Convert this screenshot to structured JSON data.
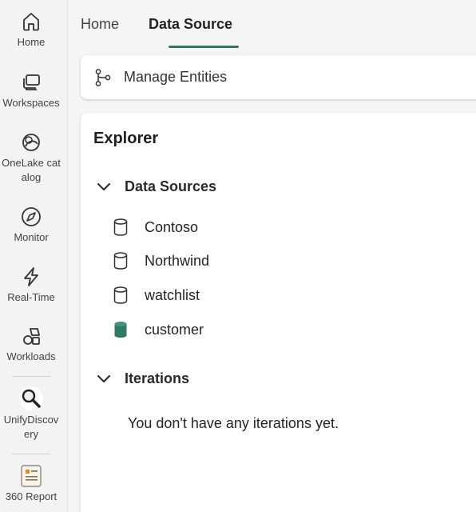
{
  "rail": {
    "items": [
      {
        "label": "Home",
        "icon": "home-icon"
      },
      {
        "label": "Workspaces",
        "icon": "workspaces-icon"
      },
      {
        "label": "OneLake catalog",
        "icon": "onelake-catalog-icon"
      },
      {
        "label": "Monitor",
        "icon": "monitor-icon"
      },
      {
        "label": "Real-Time",
        "icon": "real-time-icon"
      },
      {
        "label": "Workloads",
        "icon": "workloads-icon"
      },
      {
        "label": "UnifyDiscovery",
        "icon": "magnifier-icon"
      },
      {
        "label": "360 Report",
        "icon": "report-icon"
      }
    ]
  },
  "tabs": [
    {
      "label": "Home",
      "active": false
    },
    {
      "label": "Data Source",
      "active": true
    }
  ],
  "toolbar": {
    "manage_entities_label": "Manage Entities"
  },
  "explorer": {
    "title": "Explorer",
    "data_sources_header": "Data Sources",
    "data_sources": [
      {
        "name": "Contoso",
        "selected": false
      },
      {
        "name": "Northwind",
        "selected": false
      },
      {
        "name": "watchlist",
        "selected": false
      },
      {
        "name": "customer",
        "selected": true
      }
    ],
    "iterations_header": "Iterations",
    "iterations_empty": "You don't have any iterations yet."
  },
  "colors": {
    "accent": "#2b7a62",
    "selected_db": "#2e7b64"
  }
}
